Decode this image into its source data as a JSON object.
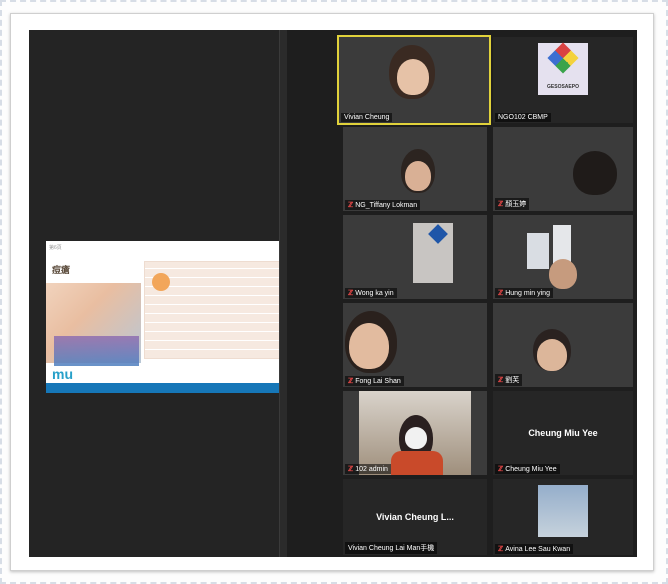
{
  "share": {
    "top_text": "第6頁",
    "title": "痘瘡",
    "logo": "mu"
  },
  "participants": [
    {
      "name": "Vivian Cheung",
      "muted": false,
      "active": true
    },
    {
      "name": "NGO102 CBMP",
      "muted": false,
      "emblem_text": "GESOSAEPO"
    },
    {
      "name": "NG_Tiffany Lokman",
      "muted": true
    },
    {
      "name": "顏玉婷",
      "muted": true
    },
    {
      "name": "Wong ka yin",
      "muted": true
    },
    {
      "name": "Hung  min ying",
      "muted": true
    },
    {
      "name": "Fong Lai Shan",
      "muted": true
    },
    {
      "name": "劉芙",
      "muted": true
    },
    {
      "name": "102 admin",
      "muted": true
    },
    {
      "name": "Cheung Miu Yee",
      "muted": true,
      "center_label": "Cheung Miu Yee"
    },
    {
      "name": "Vivian Cheung Lai Man手機",
      "muted": false,
      "center_label": "Vivian  Cheung  L..."
    },
    {
      "name": "Avina Lee Sau Kwan",
      "muted": true
    }
  ],
  "icons": {
    "mute": "muted-mic-icon"
  },
  "colors": {
    "active_border": "#e1d23b",
    "gallery_bg": "#1e1e1e",
    "mute": "#ff4d4d"
  }
}
